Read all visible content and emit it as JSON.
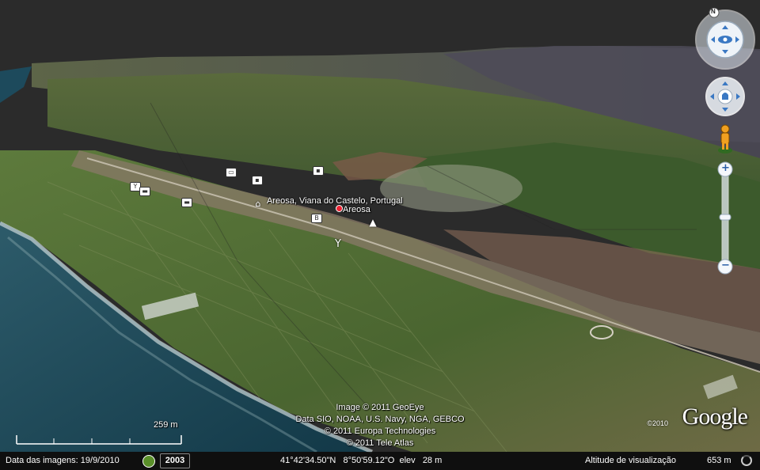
{
  "map": {
    "place_label": "Areosa, Viana do Castelo, Portugal",
    "place_sublabel": "Areosa",
    "colors": {
      "sky": "#2b2b2b",
      "ocean": "#1f4a5c",
      "fields": "#4f6b30",
      "hills": "#3f5a2c",
      "mountains_far": "#4c4f55",
      "town": "#8a7a68",
      "surf": "#c9d6d6"
    }
  },
  "credits": {
    "line1": "Image © 2011 GeoEye",
    "line2": "Data SIO, NOAA, U.S. Navy, NGA, GEBCO",
    "line3": "© 2011 Europa Technologies",
    "line4": "© 2011 Tele Atlas"
  },
  "brand": {
    "logo_text": "Google",
    "copyright_year": "©2010"
  },
  "scale": {
    "label": "259 m"
  },
  "status": {
    "imagery_date_label": "Data das imagens: 19/9/2010",
    "year_button": "2003",
    "coordinates": "41°42'34.50\"N   8°50'59.12\"O  elev   28 m",
    "eye_alt_label": "Altitude de visualização",
    "eye_alt_value": "653 m"
  },
  "nav": {
    "compass_letter": "N",
    "zoom_plus": "+",
    "zoom_minus": "−"
  }
}
